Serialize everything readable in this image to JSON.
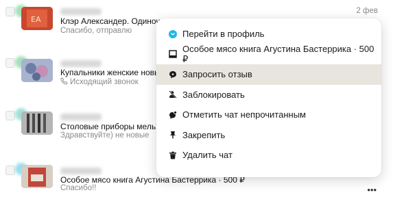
{
  "chats": [
    {
      "title": "Клэр Александер. Одиночес",
      "subtitle": "Спасибо, отправлю",
      "date": "2 фев"
    },
    {
      "title": "Купальники женские новые",
      "subtitle": "Исходящий звонок"
    },
    {
      "title": "Столовые приборы мельхио",
      "subtitle": "Здравствуйте) не новые"
    },
    {
      "title": "Особое мясо книга Агустина Бастеррика · 500 ₽",
      "subtitle": "Спасибо!!"
    }
  ],
  "row_more": "•••",
  "context_menu": {
    "items": [
      {
        "label": "Перейти в профиль",
        "icon": "profile-icon"
      },
      {
        "label": "Особое мясо книга Агустина Бастеррика · 500 ₽",
        "icon": "listing-icon"
      },
      {
        "label": "Запросить отзыв",
        "icon": "review-icon",
        "highlighted": true
      },
      {
        "label": "Заблокировать",
        "icon": "block-icon"
      },
      {
        "label": "Отметить чат непрочитанным",
        "icon": "unread-icon"
      },
      {
        "label": "Закрепить",
        "icon": "pin-icon"
      },
      {
        "label": "Удалить чат",
        "icon": "trash-icon"
      }
    ]
  },
  "colors": {
    "highlight": "#e8e5de",
    "profile_icon_bg": "#1fb7e6"
  }
}
